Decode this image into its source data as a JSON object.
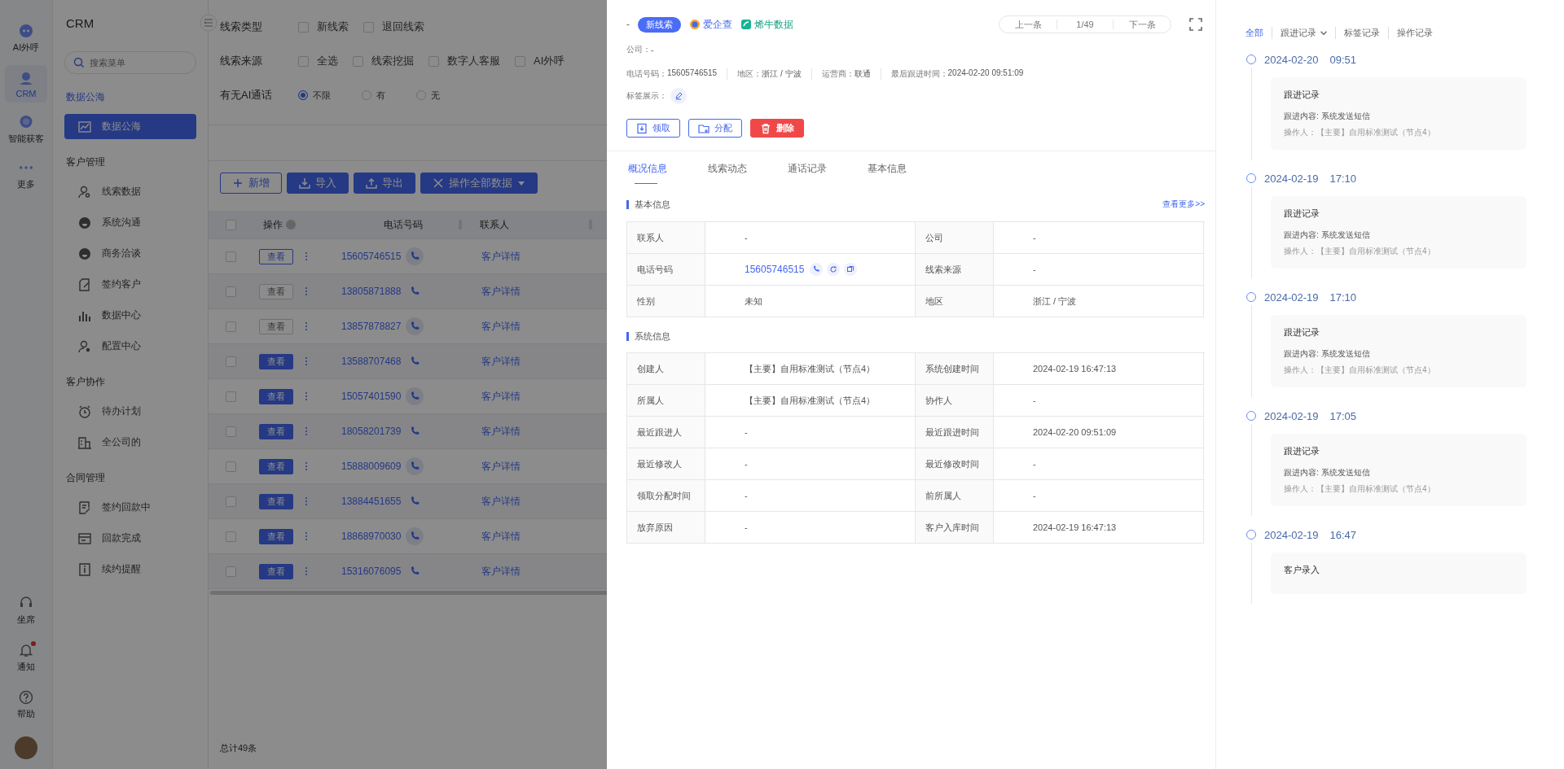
{
  "rail": {
    "top": [
      {
        "label": "AI外呼",
        "selected": false
      },
      {
        "label": "CRM",
        "selected": true
      },
      {
        "label": "智能获客",
        "selected": false
      },
      {
        "label": "更多",
        "selected": false
      }
    ],
    "bottom": [
      {
        "label": "坐席",
        "unread": false
      },
      {
        "label": "通知",
        "unread": true
      },
      {
        "label": "帮助",
        "unread": false
      }
    ]
  },
  "nav": {
    "title": "CRM",
    "search": {
      "placeholder": "搜索菜单"
    },
    "groups": [
      {
        "title": "数据公海",
        "active": true,
        "items": [
          {
            "label": "数据公海",
            "selected": true
          }
        ]
      },
      {
        "title": "客户管理",
        "active": false,
        "items": [
          {
            "label": "线索数据",
            "selected": false
          },
          {
            "label": "系统沟通",
            "selected": false
          },
          {
            "label": "商务洽谈",
            "selected": false
          },
          {
            "label": "签约客户",
            "selected": false
          },
          {
            "label": "数据中心",
            "selected": false
          },
          {
            "label": "配置中心",
            "selected": false
          }
        ]
      },
      {
        "title": "客户协作",
        "active": false,
        "items": [
          {
            "label": "待办计划",
            "selected": false
          },
          {
            "label": "全公司的",
            "selected": false
          }
        ]
      },
      {
        "title": "合同管理",
        "active": false,
        "items": [
          {
            "label": "签约回款中",
            "selected": false
          },
          {
            "label": "回款完成",
            "selected": false
          },
          {
            "label": "续约提醒",
            "selected": false
          }
        ]
      }
    ]
  },
  "filters": [
    {
      "label": "线索类型",
      "kind": "checkbox",
      "options": [
        {
          "label": "新线索",
          "checked": false
        },
        {
          "label": "退回线索",
          "checked": false
        }
      ]
    },
    {
      "label": "线索来源",
      "kind": "checkbox",
      "options": [
        {
          "label": "全选",
          "checked": false
        },
        {
          "label": "线索挖掘",
          "checked": false
        },
        {
          "label": "数字人客服",
          "checked": false
        },
        {
          "label": "AI外呼",
          "checked": false
        }
      ]
    },
    {
      "label": "有无AI通话",
      "kind": "radio",
      "options": [
        {
          "label": "不限",
          "selected": true
        },
        {
          "label": "有",
          "selected": false
        },
        {
          "label": "无",
          "selected": false
        }
      ]
    }
  ],
  "toolbar": [
    {
      "label": "新增",
      "kind": "outline"
    },
    {
      "label": "导入",
      "kind": "primary"
    },
    {
      "label": "导出",
      "kind": "primary"
    },
    {
      "label": "操作全部数据",
      "kind": "dropdown"
    }
  ],
  "table": {
    "header_checked": false,
    "columns": [
      "操作",
      "电话号码",
      "联系人"
    ],
    "rows": [
      {
        "checked": false,
        "action": "查看",
        "kind": "hover",
        "phone": "15605746515",
        "contact": "客户详情"
      },
      {
        "checked": false,
        "action": "查看",
        "kind": "plain",
        "phone": "13805871888",
        "contact": "客户详情"
      },
      {
        "checked": false,
        "action": "查看",
        "kind": "plain",
        "phone": "13857878827",
        "contact": "客户详情"
      },
      {
        "checked": false,
        "action": "查看",
        "kind": "primary",
        "phone": "13588707468",
        "contact": "客户详情"
      },
      {
        "checked": false,
        "action": "查看",
        "kind": "primary",
        "phone": "15057401590",
        "contact": "客户详情"
      },
      {
        "checked": false,
        "action": "查看",
        "kind": "primary",
        "phone": "18058201739",
        "contact": "客户详情"
      },
      {
        "checked": false,
        "action": "查看",
        "kind": "primary",
        "phone": "15888009609",
        "contact": "客户详情"
      },
      {
        "checked": false,
        "action": "查看",
        "kind": "primary",
        "phone": "13884451655",
        "contact": "客户详情"
      },
      {
        "checked": false,
        "action": "查看",
        "kind": "primary",
        "phone": "18868970030",
        "contact": "客户详情"
      },
      {
        "checked": false,
        "action": "查看",
        "kind": "primary",
        "phone": "15316076095",
        "contact": "客户详情"
      }
    ],
    "total": "总计49条"
  },
  "drawer": {
    "name": "-",
    "tag": "新线索",
    "links": [
      "爱企查",
      "烯牛数据"
    ],
    "pager": {
      "prev": "上一条",
      "position": "1/49",
      "next": "下一条"
    },
    "company": {
      "label": "公司：",
      "value": "-"
    },
    "info": [
      {
        "label": "电话号码：",
        "value": "15605746515"
      },
      {
        "label": "地区：",
        "value": "浙江 / 宁波"
      },
      {
        "label": "运营商：",
        "value": "联通"
      },
      {
        "label": "最后跟进时间：",
        "value": "2024-02-20 09:51:09"
      }
    ],
    "tags_label": "标签展示：",
    "actions": [
      {
        "label": "领取",
        "kind": "outline"
      },
      {
        "label": "分配",
        "kind": "outline"
      },
      {
        "label": "删除",
        "kind": "danger"
      }
    ],
    "tabs": [
      {
        "label": "概况信息",
        "selected": true
      },
      {
        "label": "线索动态",
        "selected": false
      },
      {
        "label": "通话记录",
        "selected": false
      },
      {
        "label": "基本信息",
        "selected": false
      }
    ],
    "sections": [
      {
        "title": "基本信息",
        "more": "查看更多>>",
        "rows": [
          [
            {
              "label": "联系人",
              "value": "-"
            },
            {
              "label": "公司",
              "value": "-"
            }
          ],
          [
            {
              "label": "电话号码",
              "value": "15605746515",
              "kind": "phone"
            },
            {
              "label": "线索来源",
              "value": "-"
            }
          ],
          [
            {
              "label": "性别",
              "value": "未知"
            },
            {
              "label": "地区",
              "value": "浙江 / 宁波"
            }
          ]
        ]
      },
      {
        "title": "系统信息",
        "rows": [
          [
            {
              "label": "创建人",
              "value": "【主要】自用标准测试（节点4）"
            },
            {
              "label": "系统创建时间",
              "value": "2024-02-19 16:47:13"
            }
          ],
          [
            {
              "label": "所属人",
              "value": "【主要】自用标准测试（节点4）"
            },
            {
              "label": "协作人",
              "value": "-"
            }
          ],
          [
            {
              "label": "最近跟进人",
              "value": "-"
            },
            {
              "label": "最近跟进时间",
              "value": "2024-02-20 09:51:09"
            }
          ],
          [
            {
              "label": "最近修改人",
              "value": "-"
            },
            {
              "label": "最近修改时间",
              "value": "-"
            }
          ],
          [
            {
              "label": "领取分配时间",
              "value": "-"
            },
            {
              "label": "前所属人",
              "value": "-"
            }
          ],
          [
            {
              "label": "放弃原因",
              "value": "-"
            },
            {
              "label": "客户入库时间",
              "value": "2024-02-19 16:47:13"
            }
          ]
        ]
      }
    ]
  },
  "timeline": {
    "tabs": [
      {
        "label": "全部",
        "selected": true,
        "dropdown": false
      },
      {
        "label": "跟进记录",
        "selected": false,
        "dropdown": true
      },
      {
        "label": "标签记录",
        "selected": false,
        "dropdown": false
      },
      {
        "label": "操作记录",
        "selected": false,
        "dropdown": false
      }
    ],
    "entries": [
      {
        "date": "2024-02-20",
        "time": "09:51",
        "title": "跟进记录",
        "content": "跟进内容: 系统发送短信",
        "operator": "操作人：【主要】自用标准测试（节点4）"
      },
      {
        "date": "2024-02-19",
        "time": "17:10",
        "title": "跟进记录",
        "content": "跟进内容: 系统发送短信",
        "operator": "操作人：【主要】自用标准测试（节点4）"
      },
      {
        "date": "2024-02-19",
        "time": "17:10",
        "title": "跟进记录",
        "content": "跟进内容: 系统发送短信",
        "operator": "操作人：【主要】自用标准测试（节点4）"
      },
      {
        "date": "2024-02-19",
        "time": "17:05",
        "title": "跟进记录",
        "content": "跟进内容: 系统发送短信",
        "operator": "操作人：【主要】自用标准测试（节点4）"
      },
      {
        "date": "2024-02-19",
        "time": "16:47",
        "title": "客户录入"
      }
    ]
  }
}
